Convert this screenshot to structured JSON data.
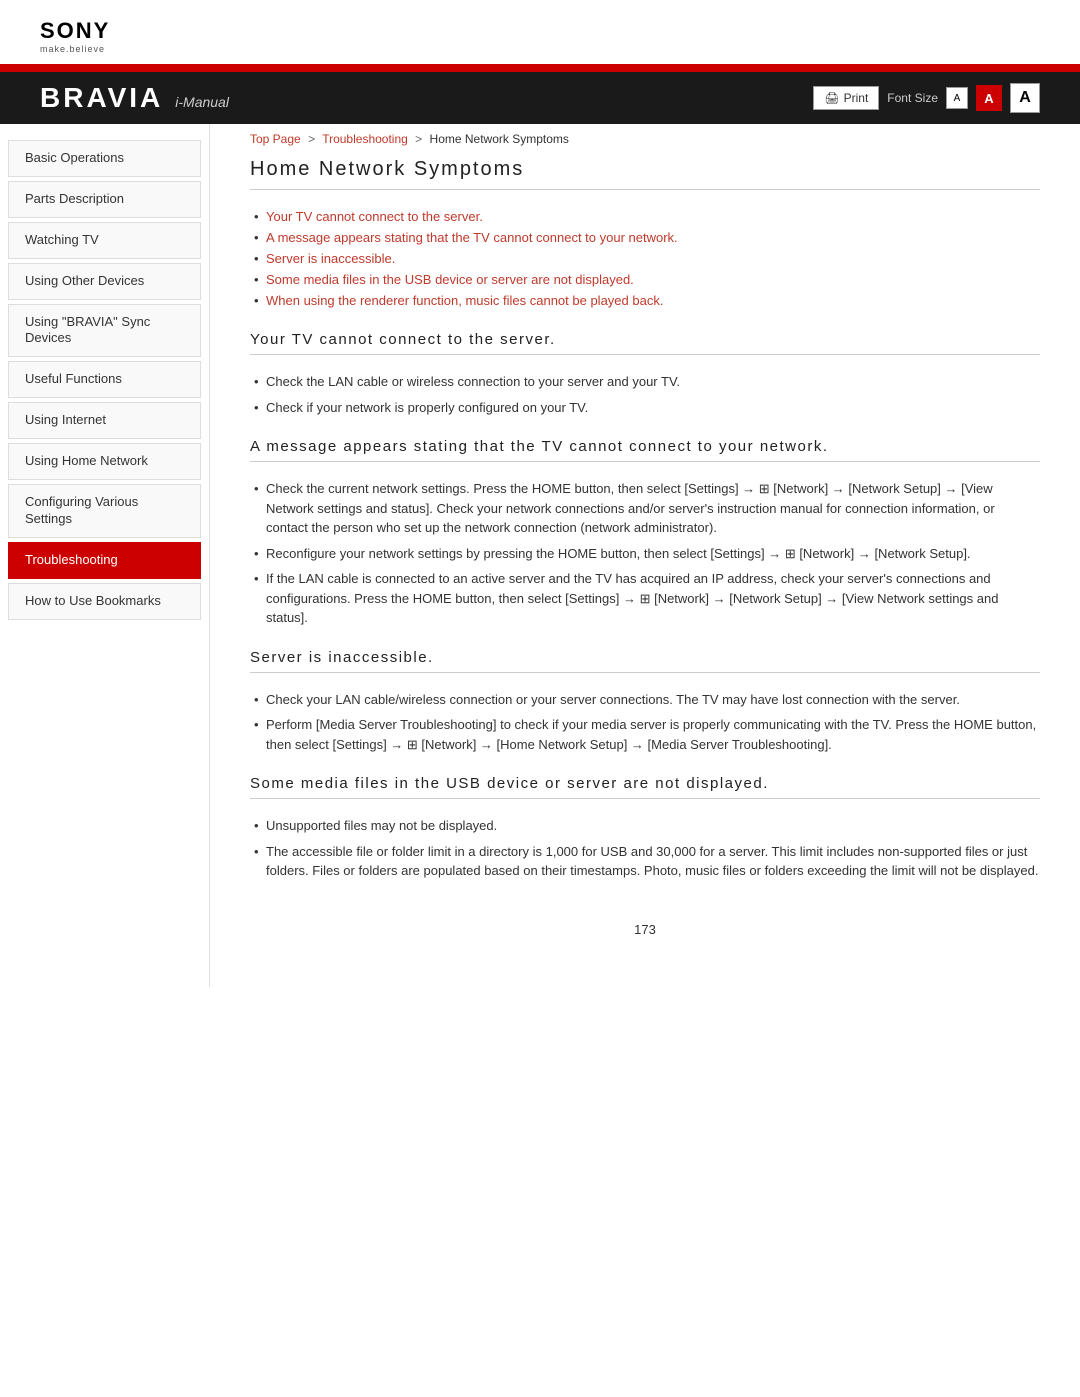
{
  "sony": {
    "logo": "SONY",
    "tagline": "make.believe"
  },
  "header": {
    "brand": "BRAVIA",
    "manual": "i-Manual",
    "print_label": "Print",
    "font_size_label": "Font Size",
    "font_small": "A",
    "font_medium": "A",
    "font_large": "A"
  },
  "breadcrumb": {
    "top_page": "Top Page",
    "troubleshooting": "Troubleshooting",
    "current": "Home Network Symptoms"
  },
  "sidebar": {
    "items": [
      {
        "id": "basic-operations",
        "label": "Basic Operations",
        "active": false
      },
      {
        "id": "parts-description",
        "label": "Parts Description",
        "active": false
      },
      {
        "id": "watching-tv",
        "label": "Watching TV",
        "active": false
      },
      {
        "id": "using-other-devices",
        "label": "Using Other Devices",
        "active": false
      },
      {
        "id": "using-bravia-sync",
        "label": "Using \"BRAVIA\" Sync Devices",
        "active": false
      },
      {
        "id": "useful-functions",
        "label": "Useful Functions",
        "active": false
      },
      {
        "id": "using-internet",
        "label": "Using Internet",
        "active": false
      },
      {
        "id": "using-home-network",
        "label": "Using Home Network",
        "active": false
      },
      {
        "id": "configuring-settings",
        "label": "Configuring Various Settings",
        "active": false
      },
      {
        "id": "troubleshooting",
        "label": "Troubleshooting",
        "active": true
      },
      {
        "id": "how-to-bookmarks",
        "label": "How to Use Bookmarks",
        "active": false
      }
    ]
  },
  "page": {
    "title": "Home Network Symptoms",
    "links": [
      "Your TV cannot connect to the server.",
      "A message appears stating that the TV cannot connect to your network.",
      "Server is inaccessible.",
      "Some media files in the USB device or server are not displayed.",
      "When using the renderer function, music files cannot be played back."
    ],
    "sections": [
      {
        "id": "tv-cannot-connect",
        "title": "Your TV cannot connect to the server.",
        "bullets": [
          "Check the LAN cable or wireless connection to your server and your TV.",
          "Check if your network is properly configured on your TV."
        ]
      },
      {
        "id": "message-appears",
        "title": "A message appears stating that the TV cannot connect to your network.",
        "bullets": [
          "Check the current network settings. Press the HOME button, then select [Settings] → ⊞ [Network] → [Network Setup] → [View Network settings and status]. Check your network connections and/or server's instruction manual for connection information, or contact the person who set up the network connection (network administrator).",
          "Reconfigure your network settings by pressing the HOME button, then select [Settings] → ⊞ [Network] → [Network Setup].",
          "If the LAN cable is connected to an active server and the TV has acquired an IP address, check your server's connections and configurations. Press the HOME button, then select [Settings] → ⊞ [Network] → [Network Setup] → [View Network settings and status]."
        ]
      },
      {
        "id": "server-inaccessible",
        "title": "Server is inaccessible.",
        "bullets": [
          "Check your LAN cable/wireless connection or your server connections. The TV may have lost connection with the server.",
          "Perform [Media Server Troubleshooting] to check if your media server is properly communicating with the TV. Press the HOME button, then select [Settings] → ⊞ [Network] → [Home Network Setup] → [Media Server Troubleshooting]."
        ]
      },
      {
        "id": "media-files-not-displayed",
        "title": "Some media files in the USB device or server are not displayed.",
        "bullets": [
          "Unsupported files may not be displayed.",
          "The accessible file or folder limit in a directory is 1,000 for USB and 30,000 for a server. This limit includes non-supported files or just folders. Files or folders are populated based on their timestamps. Photo, music files or folders exceeding the limit will not be displayed."
        ]
      }
    ],
    "page_number": "173"
  }
}
